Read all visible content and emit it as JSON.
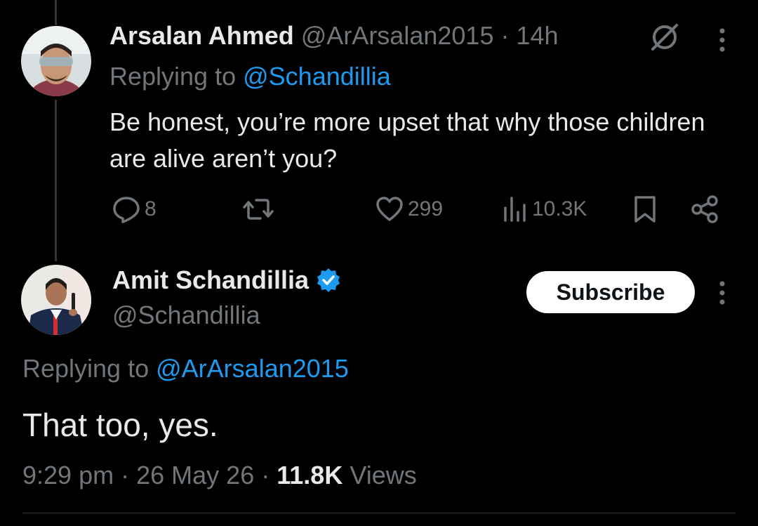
{
  "tweet1": {
    "author_name": "Arsalan Ahmed",
    "handle": "@ArArsalan2015",
    "separator": "·",
    "time": "14h",
    "replying_prefix": "Replying to",
    "replying_to": "@Schandillia",
    "body": "Be honest, you’re more upset that why those children are alive aren’t you?",
    "actions": {
      "replies": "8",
      "likes": "299",
      "views": "10.3K"
    }
  },
  "tweet2": {
    "author_name": "Amit Schandillia",
    "handle": "@Schandillia",
    "verified": true,
    "subscribe_label": "Subscribe",
    "replying_prefix": "Replying to",
    "replying_to": "@ArArsalan2015",
    "body": "That too, yes.",
    "time": "9:29 pm",
    "separator": "·",
    "date": "26 May 26",
    "views_count": "11.8K",
    "views_label": "Views"
  },
  "colors": {
    "background": "#000000",
    "text": "#e7e9ea",
    "muted": "#71767b",
    "link": "#1d9bf0",
    "verified": "#1d9bf0"
  },
  "icons": [
    "grok-icon",
    "more-icon",
    "reply-icon",
    "retweet-icon",
    "like-icon",
    "views-icon",
    "bookmark-icon",
    "share-icon",
    "verified-badge-icon"
  ]
}
